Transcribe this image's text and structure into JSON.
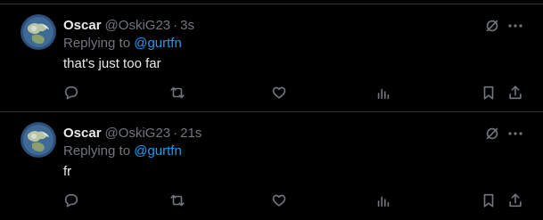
{
  "colors": {
    "background": "#000000",
    "text_primary": "#e7e9ea",
    "text_secondary": "#71767b",
    "accent": "#1d9bf0",
    "divider": "#2f3336"
  },
  "icons": [
    "grok-icon",
    "more-icon",
    "reply-icon",
    "retweet-icon",
    "like-icon",
    "views-icon",
    "bookmark-icon",
    "share-icon"
  ],
  "tweets": [
    {
      "name": "Oscar",
      "handle": "@OskiG23",
      "separator": "·",
      "time": "3s",
      "replying_prefix": "Replying to",
      "replying_to": "@gurtfn",
      "text": "that's just too far"
    },
    {
      "name": "Oscar",
      "handle": "@OskiG23",
      "separator": "·",
      "time": "21s",
      "replying_prefix": "Replying to",
      "replying_to": "@gurtfn",
      "text": "fr"
    }
  ]
}
